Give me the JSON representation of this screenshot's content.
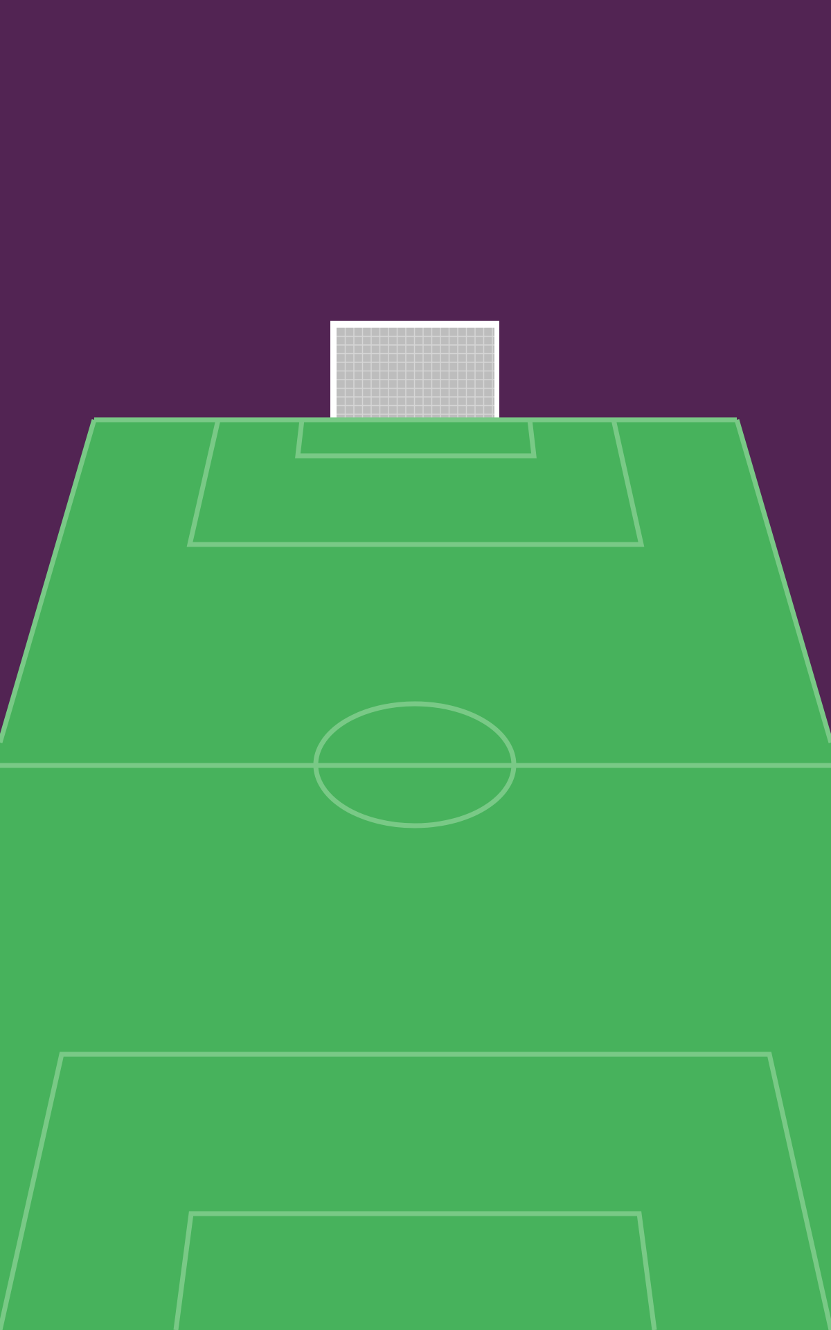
{
  "scene": {
    "background_color": "#522453",
    "field_color": "#47B25C",
    "line_color": "#79C986",
    "goal": {
      "frame_color": "#FFFFFF",
      "net_color": "#BDBDBD",
      "mesh_color": "#D6D6D6"
    }
  }
}
